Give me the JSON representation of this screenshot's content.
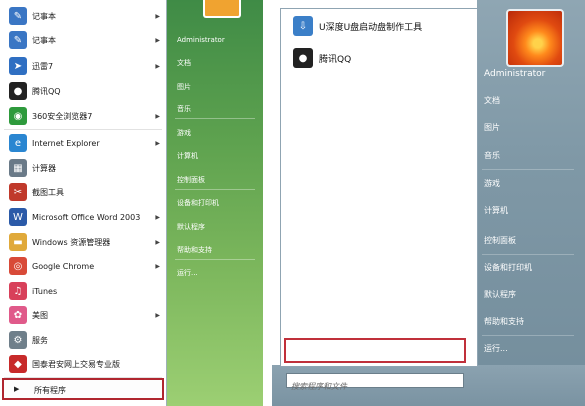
{
  "left_menu": {
    "programs": [
      {
        "label": "记事本",
        "arrow": "▶",
        "icon": "notepad-icon",
        "color": "#3a76c4"
      },
      {
        "label": "记事本",
        "arrow": "▶",
        "icon": "notepad-icon",
        "color": "#3a76c4"
      },
      {
        "label": "迅雷7",
        "arrow": "▶",
        "icon": "thunder-icon",
        "color": "#2f6fc2"
      },
      {
        "label": "腾讯QQ",
        "arrow": "",
        "icon": "qq-penguin-icon",
        "color": "#222222"
      },
      {
        "label": "360安全浏览器7",
        "arrow": "▶",
        "icon": "360-browser-icon",
        "color": "#2e9a3c"
      },
      {
        "label": "Internet Explorer",
        "arrow": "▶",
        "icon": "ie-icon",
        "color": "#2a86d1"
      },
      {
        "label": "计算器",
        "arrow": "",
        "icon": "calculator-icon",
        "color": "#6a7a88"
      },
      {
        "label": "截图工具",
        "arrow": "",
        "icon": "snipping-tool-icon",
        "color": "#c0392b"
      },
      {
        "label": "Microsoft Office Word 2003",
        "arrow": "▶",
        "icon": "word-icon",
        "color": "#2b5aa8"
      },
      {
        "label": "Windows 资源管理器",
        "arrow": "▶",
        "icon": "explorer-folder-icon",
        "color": "#e0a93a"
      },
      {
        "label": "Google Chrome",
        "arrow": "▶",
        "icon": "chrome-icon",
        "color": "#d84a38"
      },
      {
        "label": "iTunes",
        "arrow": "",
        "icon": "itunes-icon",
        "color": "#d8405a"
      },
      {
        "label": "美图",
        "arrow": "▶",
        "icon": "meitu-icon",
        "color": "#e05a8a"
      },
      {
        "label": "服务",
        "arrow": "",
        "icon": "services-gear-icon",
        "color": "#6f7f8a"
      },
      {
        "label": "国泰君安网上交易专业版",
        "arrow": "",
        "icon": "gtja-icon",
        "color": "#c72a2a"
      }
    ],
    "all_programs": "所有程序",
    "all_programs_arrow": "▶",
    "right_pane": {
      "user": "Administrator",
      "items": [
        "文档",
        "图片",
        "音乐",
        "游戏",
        "计算机",
        "控制面板",
        "设备和打印机",
        "默认程序",
        "帮助和支持",
        "运行..."
      ]
    }
  },
  "right_menu": {
    "programs": [
      {
        "label": "U深度U盘启动盘制作工具",
        "icon": "usb-drive-icon",
        "color": "#3b7fc8"
      },
      {
        "label": "腾讯QQ",
        "icon": "qq-penguin-icon",
        "color": "#222222"
      }
    ],
    "search_placeholder": "搜索程序和文件",
    "right_pane": {
      "user": "Administrator",
      "items": [
        "文档",
        "图片",
        "音乐",
        "游戏",
        "计算机",
        "控制面板",
        "设备和打印机",
        "默认程序",
        "帮助和支持",
        "运行..."
      ]
    }
  }
}
